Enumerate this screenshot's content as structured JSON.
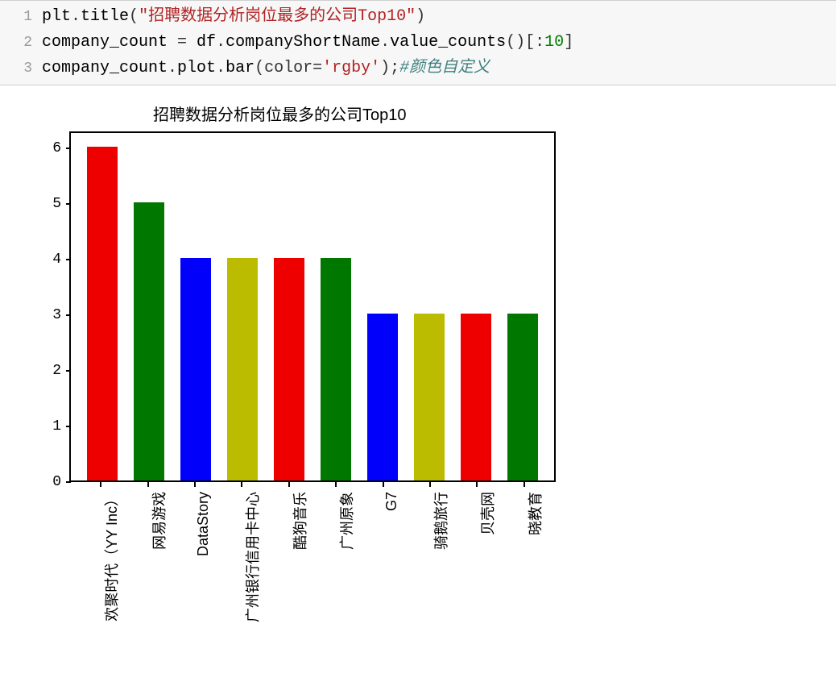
{
  "code": {
    "lines": [
      {
        "num": "1",
        "tokens": [
          "plt",
          ".",
          "title",
          "(",
          "\"招聘数据分析岗位最多的公司Top10\"",
          ")"
        ]
      },
      {
        "num": "2",
        "tokens": [
          "company_count",
          " = ",
          "df",
          ".",
          "companyShortName",
          ".",
          "value_counts",
          "()[:10]"
        ]
      },
      {
        "num": "3",
        "tokens": [
          "company_count",
          ".",
          "plot",
          ".",
          "bar",
          "(",
          "color",
          "=",
          "'rgby'",
          ");",
          "#颜色自定义"
        ]
      }
    ],
    "line1": {
      "num": "1",
      "p1": "plt",
      "p2": ".",
      "p3": "title",
      "p4": "(",
      "p5": "\"招聘数据分析岗位最多的公司Top10\"",
      "p6": ")"
    },
    "line2": {
      "num": "2",
      "p1": "company_count ",
      "p2": "=",
      "p3": " df",
      "p4": ".",
      "p5": "companyShortName",
      "p6": ".",
      "p7": "value_counts",
      "p8": "()[:",
      "p9": "10",
      "p10": "]"
    },
    "line3": {
      "num": "3",
      "p1": "company_count",
      "p2": ".",
      "p3": "plot",
      "p4": ".",
      "p5": "bar",
      "p6": "(color",
      "p7": "=",
      "p8": "'rgby'",
      "p9": ");",
      "p10": "#颜色自定义"
    }
  },
  "chart_data": {
    "type": "bar",
    "title": "招聘数据分析岗位最多的公司Top10",
    "categories": [
      "欢聚时代（YY Inc）",
      "网易游戏",
      "DataStory",
      "广州银行信用卡中心",
      "酷狗音乐",
      "广州原象",
      "G7",
      "骑鹅旅行",
      "贝壳网",
      "晓教育"
    ],
    "values": [
      6,
      5,
      4,
      4,
      4,
      4,
      3,
      3,
      3,
      3
    ],
    "colors": [
      "#ef0000",
      "#007800",
      "#0000fb",
      "#bbbb00",
      "#ef0000",
      "#007800",
      "#0000fb",
      "#bbbb00",
      "#ef0000",
      "#007800"
    ],
    "yticks": [
      "0",
      "1",
      "2",
      "3",
      "4",
      "5",
      "6"
    ],
    "ylim": [
      0,
      6.3
    ]
  }
}
